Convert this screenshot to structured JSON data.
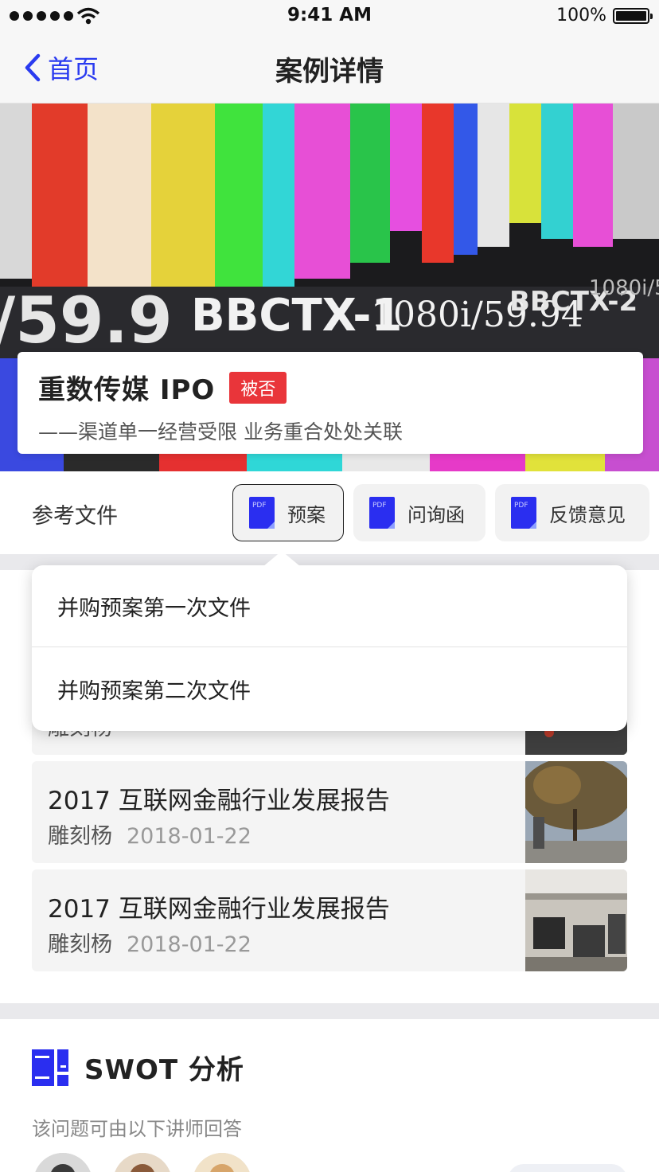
{
  "status_bar": {
    "time": "9:41 AM",
    "battery": "100%"
  },
  "nav": {
    "back_label": "首页",
    "title": "案例详情"
  },
  "hero": {
    "image": "broadcast test pattern monitor",
    "overlay_text": [
      "BBCTX-1",
      "1080i/59.94",
      "BBCTX-2",
      "59.9"
    ]
  },
  "case": {
    "title": "重数传媒 IPO",
    "status": "被否",
    "subtitle": "——渠道单一经营受限 业务重合处处关联"
  },
  "refs": {
    "label": "参考文件",
    "buttons": [
      {
        "label": "预案",
        "icon": "pdf-icon",
        "active": true
      },
      {
        "label": "问询函",
        "icon": "pdf-icon",
        "active": false
      },
      {
        "label": "反馈意见",
        "icon": "pdf-icon",
        "active": false
      }
    ]
  },
  "dropdown": {
    "items": [
      "并购预案第一次文件",
      "并购预案第二次文件"
    ]
  },
  "articles": [
    {
      "title": "",
      "author": "雕刻杨",
      "date": "",
      "thumb": "outdoor scene"
    },
    {
      "title": "2017 互联网金融行业发展报告",
      "author": "雕刻杨",
      "date": "2018-01-22",
      "thumb": "tree-lined street"
    },
    {
      "title": "2017 互联网金融行业发展报告",
      "author": "雕刻杨",
      "date": "2018-01-22",
      "thumb": "mall interior"
    }
  ],
  "swot": {
    "title": "SWOT 分析",
    "icon": "swot-icon",
    "description": "该问题可由以下讲师回答"
  },
  "colors": {
    "accent": "#2a3bf0",
    "tag_red": "#e9353a",
    "band_gray": "#e9e9ec"
  }
}
